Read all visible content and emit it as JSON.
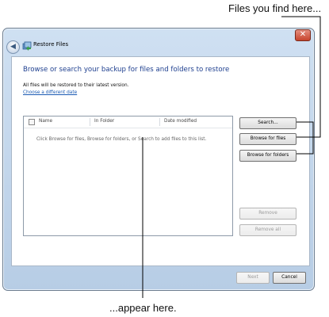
{
  "callouts": {
    "top": "Files you find here...",
    "bottom": "...appear here."
  },
  "window": {
    "title": "Restore Files",
    "close_glyph": "✕",
    "back_glyph": "◀"
  },
  "content": {
    "heading": "Browse or search your backup for files and folders to restore",
    "info": "All files will be restored to their latest version.",
    "link": "Choose a different date"
  },
  "file_list": {
    "columns": [
      "Name",
      "In Folder",
      "Date modified"
    ],
    "empty_message": "Click Browse for files, Browse for folders, or Search to add files to this list."
  },
  "buttons": {
    "search": "Search...",
    "browse_files": "Browse for files",
    "browse_folders": "Browse for folders",
    "remove": "Remove",
    "remove_all": "Remove all",
    "next": "Next",
    "cancel": "Cancel"
  },
  "icons": {
    "back": "back-arrow-icon",
    "app": "restore-files-icon",
    "close": "close-icon"
  }
}
